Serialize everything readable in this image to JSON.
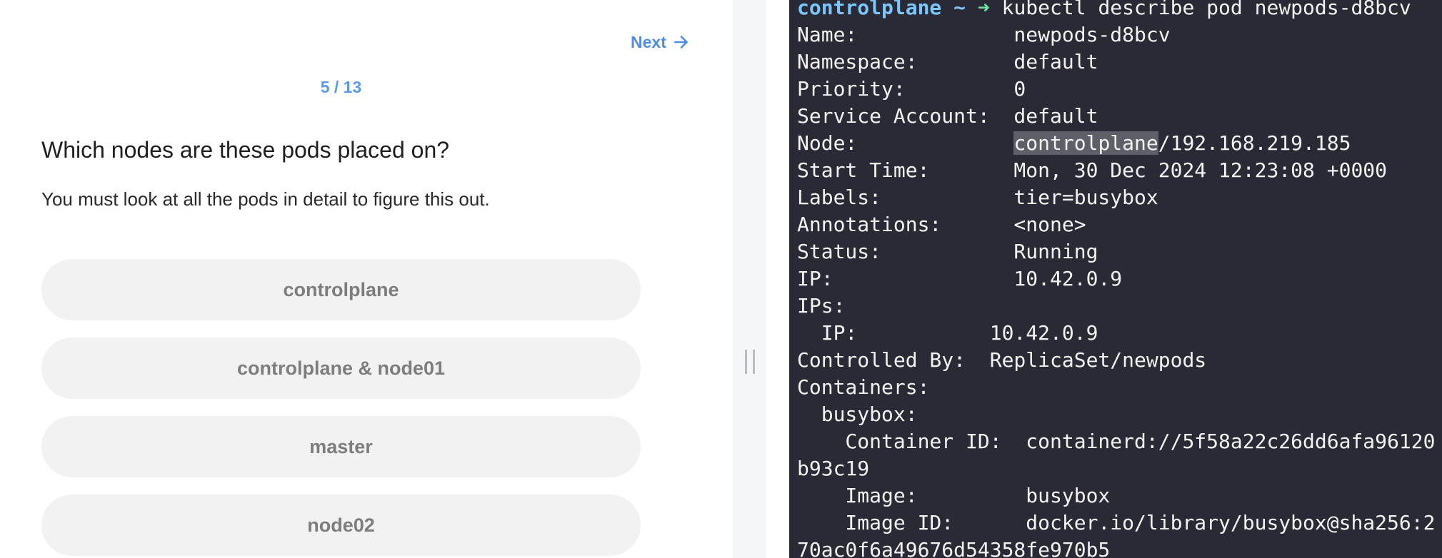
{
  "quiz": {
    "next_label": "Next",
    "progress": "5 / 13",
    "question": "Which nodes are these pods placed on?",
    "hint": "You must look at all the pods in detail to figure this out.",
    "options": [
      "controlplane",
      "controlplane & node01",
      "master",
      "node02"
    ]
  },
  "terminal": {
    "prompt_host": "controlplane ~",
    "prompt_arrow": "➜",
    "command": "kubectl describe pod newpods-d8bcv",
    "node_line": {
      "label": "Node:             ",
      "highlighted": "controlplane",
      "rest": "/192.168.219.185"
    },
    "lines": [
      "Name:             newpods-d8bcv",
      "Namespace:        default",
      "Priority:         0",
      "Service Account:  default",
      "Start Time:       Mon, 30 Dec 2024 12:23:08 +0000",
      "Labels:           tier=busybox",
      "Annotations:      <none>",
      "Status:           Running",
      "IP:               10.42.0.9",
      "IPs:",
      "  IP:           10.42.0.9",
      "Controlled By:  ReplicaSet/newpods",
      "Containers:",
      "  busybox:",
      "    Container ID:  containerd://5f58a22c26dd6afa96120",
      "b93c19",
      "    Image:         busybox",
      "    Image ID:      docker.io/library/busybox@sha256:2",
      "70ac0f6a49676d54358fe970b5"
    ]
  },
  "colors": {
    "accent": "#4f8fe0",
    "terminal_bg": "#292a36",
    "prompt_host": "#7cc6fb",
    "prompt_arrow": "#71e6a5",
    "option_bg": "#f2f2f2"
  }
}
